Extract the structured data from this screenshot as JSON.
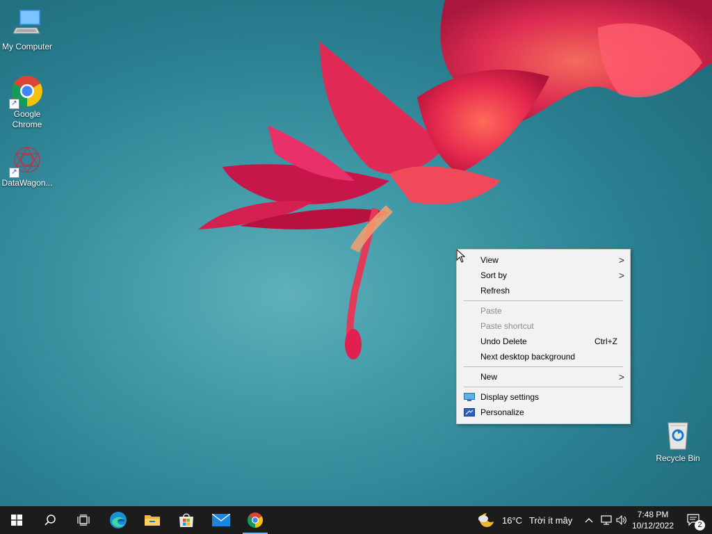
{
  "desktop": {
    "icons": [
      {
        "label": "My Computer"
      },
      {
        "label": "Google Chrome"
      },
      {
        "label": "DataWagon..."
      },
      {
        "label": "Recycle Bin"
      }
    ]
  },
  "context_menu": {
    "view": "View",
    "sort_by": "Sort by",
    "refresh": "Refresh",
    "paste": "Paste",
    "paste_shortcut": "Paste shortcut",
    "undo_delete": "Undo Delete",
    "undo_shortcut": "Ctrl+Z",
    "next_background": "Next desktop background",
    "new": "New",
    "display_settings": "Display settings",
    "personalize": "Personalize"
  },
  "taskbar": {
    "weather_temp": "16°C",
    "weather_desc": "Trời ít mây",
    "time": "7:48 PM",
    "date": "10/12/2022",
    "notification_count": "2"
  },
  "colors": {
    "taskbar": "#1c1c1c",
    "menu_bg": "#f2f2f2",
    "accent": "#0078d7"
  }
}
